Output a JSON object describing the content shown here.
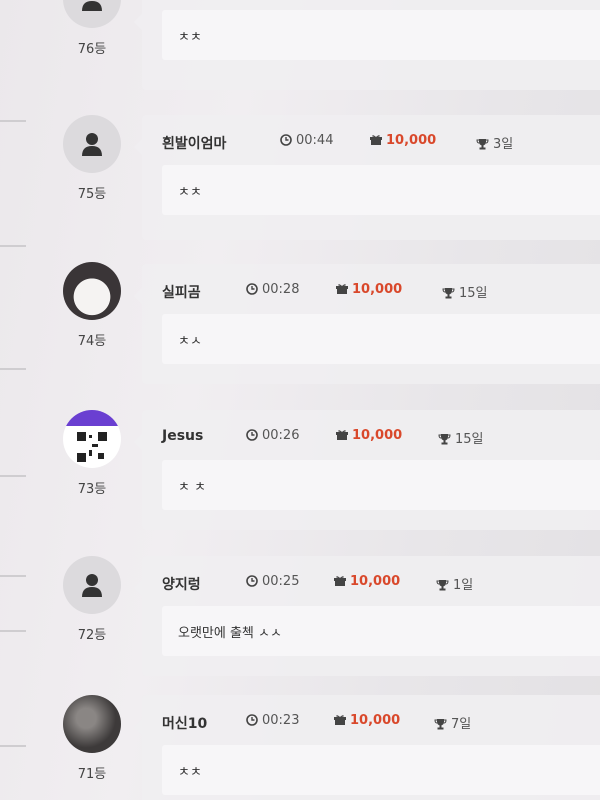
{
  "entries": [
    {
      "rank": "76등",
      "name": "",
      "time": "",
      "gift": "",
      "days": "",
      "comment": "ㅊㅊ"
    },
    {
      "rank": "75등",
      "name": "흰발이엄마",
      "time": "00:44",
      "gift": "10,000",
      "days": "3일",
      "comment": "ㅊㅊ"
    },
    {
      "rank": "74등",
      "name": "실피곰",
      "time": "00:28",
      "gift": "10,000",
      "days": "15일",
      "comment": "ㅊㅅ"
    },
    {
      "rank": "73등",
      "name": "Jesus",
      "time": "00:26",
      "gift": "10,000",
      "days": "15일",
      "comment": "ㅊ ㅊ"
    },
    {
      "rank": "72등",
      "name": "양지렁",
      "time": "00:25",
      "gift": "10,000",
      "days": "1일",
      "comment": "오랫만에 출첵 ㅅㅅ"
    },
    {
      "rank": "71등",
      "name": "머신10",
      "time": "00:23",
      "gift": "10,000",
      "days": "7일",
      "comment": "ㅊㅊ"
    }
  ],
  "icons": {
    "default_avatar": "person-icon",
    "time": "clock-icon",
    "gift": "gift-icon",
    "days": "trophy-icon"
  },
  "colors": {
    "gift_amount": "#d9482b"
  }
}
